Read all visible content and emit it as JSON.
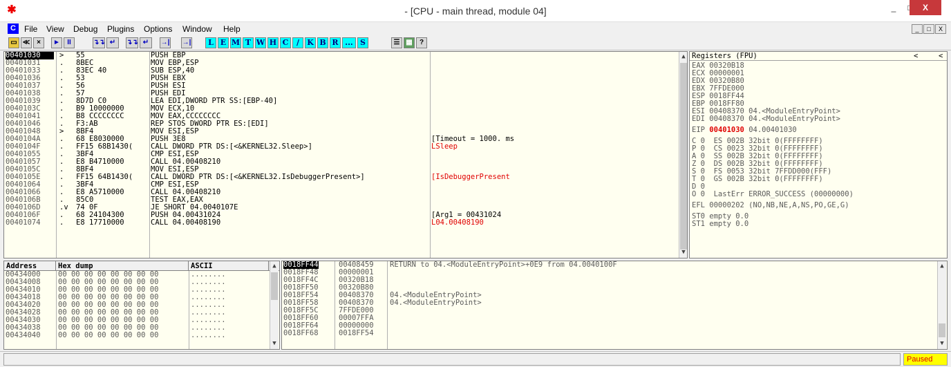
{
  "window": {
    "title": "- [CPU - main thread, module 04]",
    "app_icon": "bug-icon",
    "controls": [
      "_",
      "□",
      "X"
    ]
  },
  "menu": {
    "icon_label": "C",
    "items": [
      "File",
      "View",
      "Debug",
      "Plugins",
      "Options",
      "Window",
      "Help"
    ],
    "mdi": [
      "_",
      "□",
      "X"
    ]
  },
  "toolbar": {
    "nav_buttons": [
      "≪",
      "×",
      "►",
      "II"
    ],
    "step_buttons": [
      "↴↴",
      "↵",
      "↴↴",
      "↵"
    ],
    "letters": [
      "L",
      "E",
      "M",
      "T",
      "W",
      "H",
      "C",
      "/",
      "K",
      "B",
      "R",
      "...",
      "S"
    ],
    "help": "?"
  },
  "cpu": {
    "rows": [
      {
        "addr": "00401030",
        "mark": "> ",
        "hex": "55",
        "asm": "PUSH EBP",
        "cmt": "",
        "sel": true
      },
      {
        "addr": "00401031",
        "mark": ". ",
        "hex": "8BEC",
        "asm": "MOV EBP,ESP",
        "cmt": ""
      },
      {
        "addr": "00401033",
        "mark": ". ",
        "hex": "83EC 40",
        "asm": "SUB ESP,40",
        "cmt": ""
      },
      {
        "addr": "00401036",
        "mark": ". ",
        "hex": "53",
        "asm": "PUSH EBX",
        "cmt": ""
      },
      {
        "addr": "00401037",
        "mark": ". ",
        "hex": "56",
        "asm": "PUSH ESI",
        "cmt": ""
      },
      {
        "addr": "00401038",
        "mark": ". ",
        "hex": "57",
        "asm": "PUSH EDI",
        "cmt": ""
      },
      {
        "addr": "00401039",
        "mark": ". ",
        "hex": "8D7D C0",
        "asm": "LEA EDI,DWORD PTR SS:[EBP-40]",
        "cmt": ""
      },
      {
        "addr": "0040103C",
        "mark": ". ",
        "hex": "B9 10000000",
        "asm": "MOV ECX,10",
        "cmt": ""
      },
      {
        "addr": "00401041",
        "mark": ". ",
        "hex": "B8 CCCCCCCC",
        "asm": "MOV EAX,CCCCCCCC",
        "cmt": ""
      },
      {
        "addr": "00401046",
        "mark": ". ",
        "hex": "F3:AB",
        "asm": "REP STOS DWORD PTR ES:[EDI]",
        "cmt": ""
      },
      {
        "addr": "00401048",
        "mark": "> ",
        "hex": "8BF4",
        "asm": "MOV ESI,ESP",
        "cmt": ""
      },
      {
        "addr": "0040104A",
        "mark": ". ",
        "hex": "68 E8030000",
        "asm": "PUSH 3E8",
        "cmt": "[Timeout = 1000. ms"
      },
      {
        "addr": "0040104F",
        "mark": ". ",
        "hex": "FF15 68B1430(",
        "asm": "CALL DWORD PTR DS:[<&KERNEL32.Sleep>]",
        "cmt": "LSleep",
        "cmt_red": true
      },
      {
        "addr": "00401055",
        "mark": ". ",
        "hex": "3BF4",
        "asm": "CMP ESI,ESP",
        "cmt": ""
      },
      {
        "addr": "00401057",
        "mark": ". ",
        "hex": "E8 B4710000",
        "asm": "CALL 04.00408210",
        "cmt": ""
      },
      {
        "addr": "0040105C",
        "mark": ". ",
        "hex": "8BF4",
        "asm": "MOV ESI,ESP",
        "cmt": ""
      },
      {
        "addr": "0040105E",
        "mark": ". ",
        "hex": "FF15 64B1430(",
        "asm": "CALL DWORD PTR DS:[<&KERNEL32.IsDebuggerPresent>]",
        "cmt": "[IsDebuggerPresent",
        "cmt_red": true
      },
      {
        "addr": "00401064",
        "mark": ". ",
        "hex": "3BF4",
        "asm": "CMP ESI,ESP",
        "cmt": ""
      },
      {
        "addr": "00401066",
        "mark": ". ",
        "hex": "E8 A5710000",
        "asm": "CALL 04.00408210",
        "cmt": ""
      },
      {
        "addr": "0040106B",
        "mark": ". ",
        "hex": "85C0",
        "asm": "TEST EAX,EAX",
        "cmt": ""
      },
      {
        "addr": "0040106D",
        "mark": ".v",
        "hex": "74 0F",
        "asm": "JE SHORT 04.0040107E",
        "cmt": ""
      },
      {
        "addr": "0040106F",
        "mark": ". ",
        "hex": "68 24104300",
        "asm": "PUSH 04.00431024",
        "cmt": "[Arg1 = 00431024"
      },
      {
        "addr": "00401074",
        "mark": ". ",
        "hex": "E8 17710000",
        "asm": "CALL 04.00408190",
        "cmt": "L04.00408190",
        "cmt_red": true
      }
    ]
  },
  "registers": {
    "title": "Registers (FPU)",
    "nav": [
      "<",
      "<"
    ],
    "lines": [
      "EAX 00320B18",
      "ECX 00000001",
      "EDX 00320B80",
      "EBX 7FFDE000",
      "ESP 0018FF44",
      "EBP 0018FF80",
      "ESI 00408370 04.<ModuleEntryPoint>",
      "EDI 00408370 04.<ModuleEntryPoint>",
      "",
      "EIP_LINE",
      "",
      "C 0  ES 002B 32bit 0(FFFFFFFF)",
      "P 0  CS 0023 32bit 0(FFFFFFFF)",
      "A 0  SS 002B 32bit 0(FFFFFFFF)",
      "Z 0  DS 002B 32bit 0(FFFFFFFF)",
      "S 0  FS 0053 32bit 7FFDD000(FFF)",
      "T 0  GS 002B 32bit 0(FFFFFFFF)",
      "D 0",
      "O 0  LastErr ERROR_SUCCESS (00000000)",
      "",
      "EFL 00000202 (NO,NB,NE,A,NS,PO,GE,G)",
      "",
      "ST0 empty 0.0",
      "ST1 empty 0.0"
    ],
    "eip_label": "EIP ",
    "eip_value": "00401030",
    "eip_rest": " 04.00401030"
  },
  "dump": {
    "headers": [
      "Address",
      "Hex dump",
      "ASCII"
    ],
    "rows": [
      {
        "addr": "00434000",
        "hex": "00 00 00 00 00 00 00 00",
        "ascii": "........"
      },
      {
        "addr": "00434008",
        "hex": "00 00 00 00 00 00 00 00",
        "ascii": "........"
      },
      {
        "addr": "00434010",
        "hex": "00 00 00 00 00 00 00 00",
        "ascii": "........"
      },
      {
        "addr": "00434018",
        "hex": "00 00 00 00 00 00 00 00",
        "ascii": "........"
      },
      {
        "addr": "00434020",
        "hex": "00 00 00 00 00 00 00 00",
        "ascii": "........"
      },
      {
        "addr": "00434028",
        "hex": "00 00 00 00 00 00 00 00",
        "ascii": "........"
      },
      {
        "addr": "00434030",
        "hex": "00 00 00 00 00 00 00 00",
        "ascii": "........"
      },
      {
        "addr": "00434038",
        "hex": "00 00 00 00 00 00 00 00",
        "ascii": "........"
      },
      {
        "addr": "00434040",
        "hex": "00 00 00 00 00 00 00 00",
        "ascii": "........"
      }
    ]
  },
  "stack": {
    "rows": [
      {
        "addr": "0018FF44",
        "val": "00408459",
        "cmt": "RETURN to 04.<ModuleEntryPoint>+0E9 from 04.0040100F",
        "sel": true
      },
      {
        "addr": "0018FF48",
        "val": "00000001",
        "cmt": ""
      },
      {
        "addr": "0018FF4C",
        "val": "00320B18",
        "cmt": ""
      },
      {
        "addr": "0018FF50",
        "val": "00320B80",
        "cmt": ""
      },
      {
        "addr": "0018FF54",
        "val": "00408370",
        "cmt": "04.<ModuleEntryPoint>"
      },
      {
        "addr": "0018FF58",
        "val": "00408370",
        "cmt": "04.<ModuleEntryPoint>"
      },
      {
        "addr": "0018FF5C",
        "val": "7FFDE000",
        "cmt": ""
      },
      {
        "addr": "0018FF60",
        "val": "00007FFA",
        "cmt": ""
      },
      {
        "addr": "0018FF64",
        "val": "00000000",
        "cmt": ""
      },
      {
        "addr": "0018FF68",
        "val": "0018FF54",
        "cmt": ""
      }
    ]
  },
  "status": {
    "text": "",
    "state": "Paused"
  },
  "colors": {
    "pane_bg": "#fffff0",
    "highlight": "#e00000",
    "status_bg": "#ffff00",
    "close_btn": "#c7383b"
  }
}
